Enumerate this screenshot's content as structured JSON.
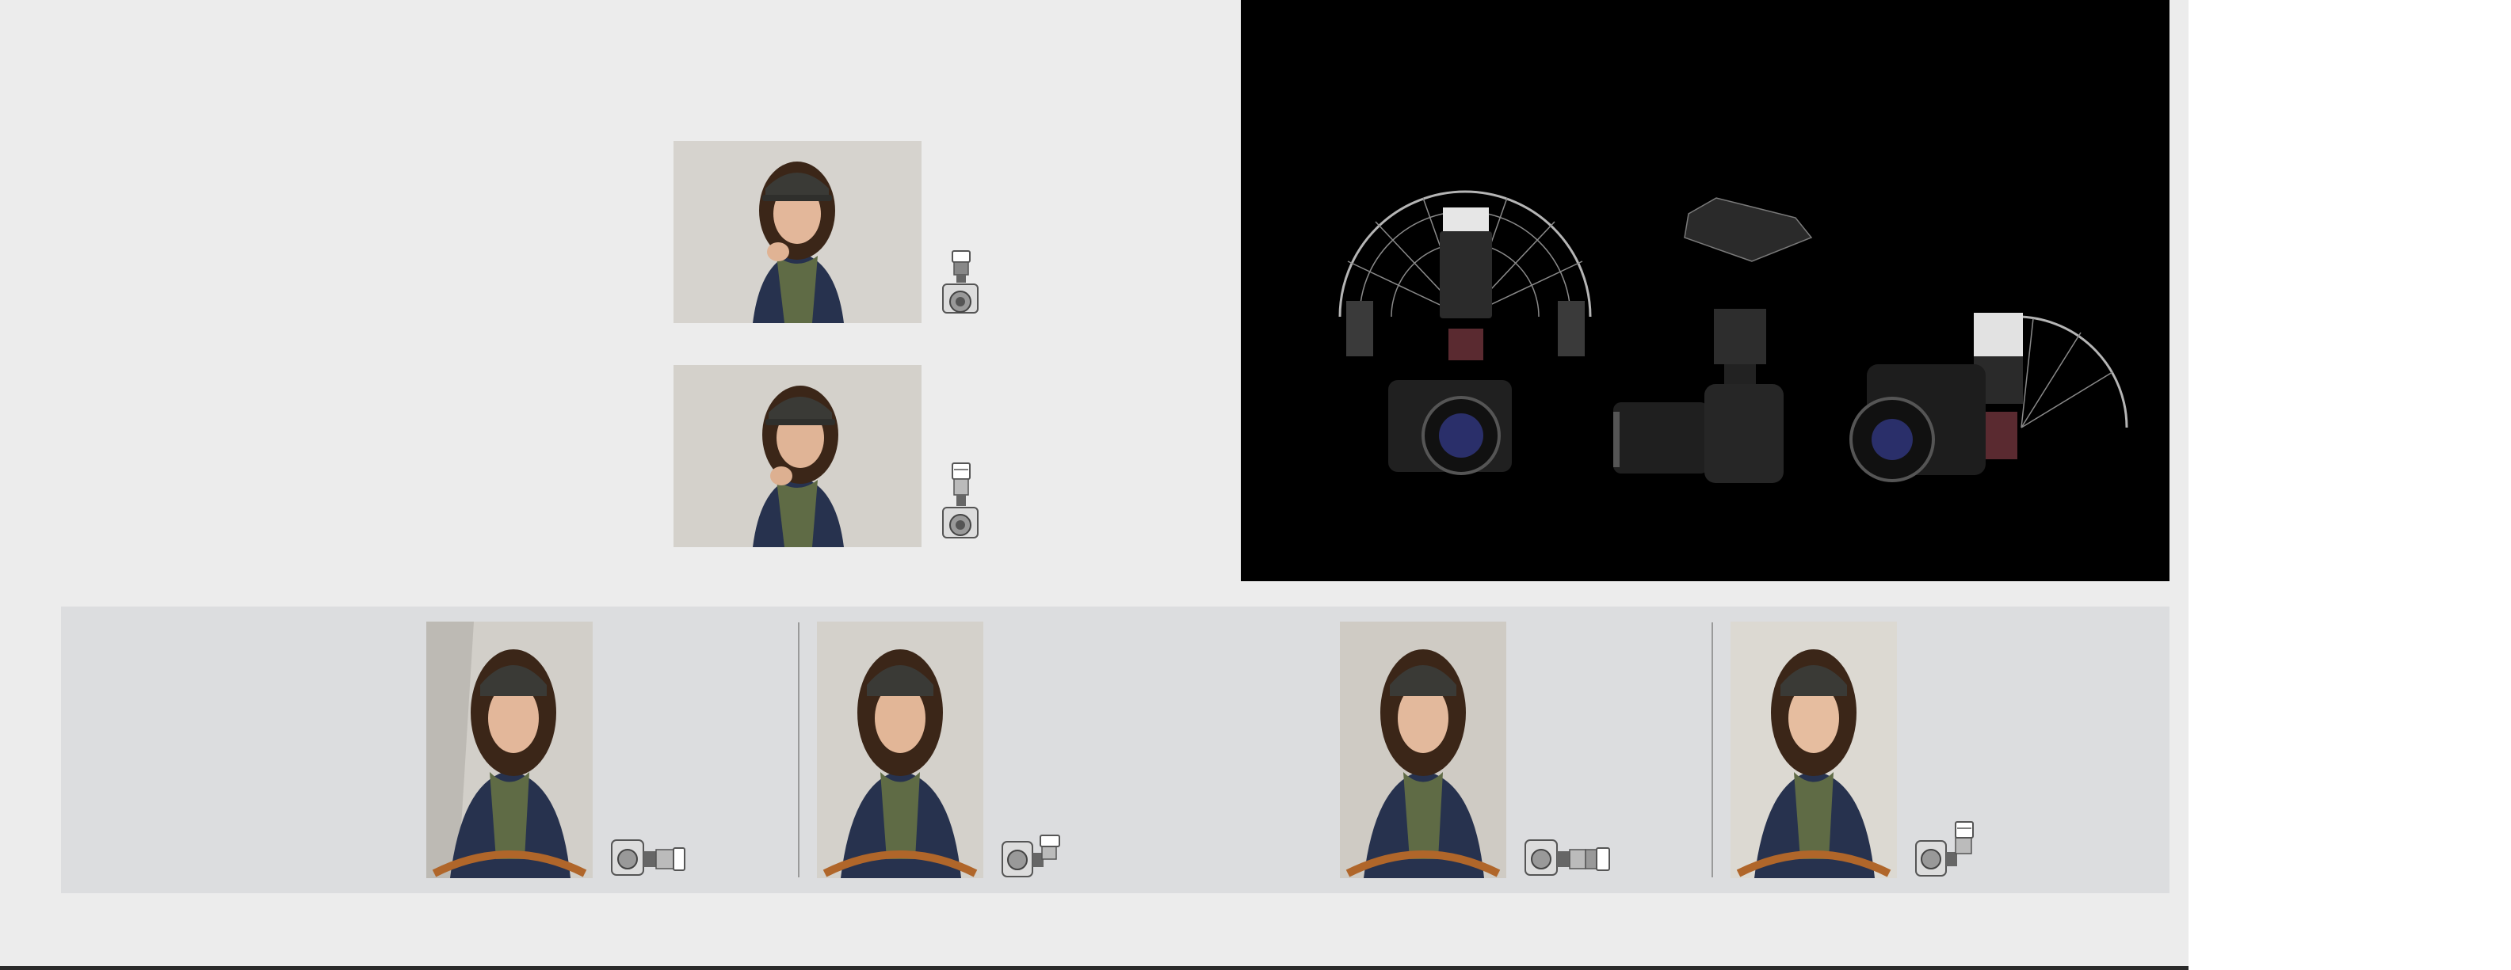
{
  "hero": {
    "description_label": ""
  },
  "top_examples": [
    {
      "id": "direct-flash",
      "gear_icon": "camera-flash-upright-icon"
    },
    {
      "id": "bounce-flash",
      "gear_icon": "camera-flash-tilted-icon"
    }
  ],
  "bottom_examples": [
    {
      "id": "side-direct",
      "gear_icon": "camera-side-flash-icon"
    },
    {
      "id": "side-bounce",
      "gear_icon": "camera-side-flash-angled-icon"
    },
    {
      "id": "side-direct-2",
      "gear_icon": "camera-side-flash-icon"
    },
    {
      "id": "side-bounce-2",
      "gear_icon": "camera-side-flash-upright-icon"
    }
  ],
  "footer": {
    "caption": ""
  },
  "colors": {
    "page_bg": "#ececec",
    "compare_bg": "#dcdddf",
    "hero_bg": "#000000"
  }
}
